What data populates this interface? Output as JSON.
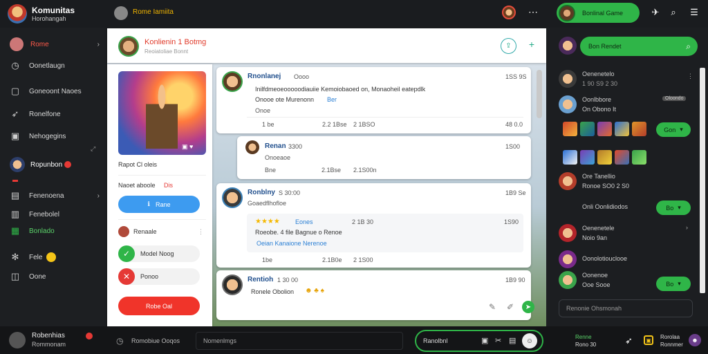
{
  "app": {
    "title": "Komunitas",
    "subtitle": "Horohangah"
  },
  "topbar": {
    "search_text": "Rome Iamiita",
    "right_label": "Bonlinal Game"
  },
  "sidebar": {
    "items": [
      {
        "label": "Rome"
      },
      {
        "label": "Oonetlaugn"
      },
      {
        "label": "Goneoont Naoes"
      },
      {
        "label": "Ronelfone"
      },
      {
        "label": "Nehogegins"
      },
      {
        "label": "Ropunbon"
      },
      {
        "label": "Fenenoena"
      },
      {
        "label": "Fenebolel"
      },
      {
        "label": "Bonlado"
      },
      {
        "label": "Fele"
      },
      {
        "label": "Oone"
      }
    ],
    "profile": {
      "name": "Robenhias",
      "sub": "Rommonam"
    }
  },
  "header": {
    "title": "Konlienin 1 Botmg",
    "subtitle": "Reoiatoliae Bonnt"
  },
  "leftcard": {
    "game_label": "Rapot Cl oleis",
    "next_label": "Naoet aboole",
    "next_badge": "Dis",
    "button_label": "Rane",
    "list": [
      {
        "label": "Renaale"
      },
      {
        "label": "Model Noog"
      },
      {
        "label": "Ponoo"
      }
    ],
    "danger_button": "Robe Oal"
  },
  "posts": [
    {
      "name": "Rnonlanej",
      "meta": "Oooo",
      "time": "1SS 9S",
      "text_line1": "Inilfdmeoeooooodiauiie Kemoiobaoed on, Monaoheil eatepdlk",
      "text_line2": "Onooe  ote Murenonn",
      "link": "Ber",
      "text_line3": "Onoe",
      "stat1": "1 be",
      "stat2": "2.2 1Bse",
      "stat3": "2 1BSO",
      "action": "48 0.0"
    },
    {
      "name": "Renan",
      "meta": "3300",
      "time": "1S00",
      "text_line1": "Onoeaoe",
      "stat1": "Bne",
      "stat2": "2.1Bse",
      "stat3": "2.1S00n"
    },
    {
      "name": "Ronblny",
      "meta": "S 30:00",
      "time": "1B9 Se",
      "text_line1": "Goaedflhofloe",
      "stars": "★★★★",
      "sub_name": "Eones",
      "sub_time": "2 1B 30",
      "sub_time2": "1S90",
      "sub_text1": "Roeobe. 4 file  Bagnue o Renoe",
      "sub_link": "Oeian Kanaione Nerenoe",
      "stat1": "1be",
      "stat2": "2.1B0e",
      "stat3": "2 1S00"
    },
    {
      "name": "Rentioh",
      "meta": "1 30 00",
      "time": "1B9 90",
      "text_line1": "Ronele Obolion"
    }
  ],
  "right": {
    "search_label": "Bon Rendet",
    "rows": [
      {
        "name": "Oenenetelo",
        "sub": "1 90 S9 2 30"
      },
      {
        "name": "Oonlbbore",
        "sub": "On Obono It",
        "badge": "Oloondo"
      },
      {
        "name": "Ore Tanellio",
        "sub": "Ronoe SO0 2 S0"
      },
      {
        "name": "Onli Oonlidiodos",
        "action": "Bo"
      },
      {
        "name": "Oenenetele",
        "sub": "Noio 9an"
      },
      {
        "name": "Oonolotiouclooe"
      },
      {
        "name": "Oonenoe",
        "sub": "Ooe Sooe"
      }
    ],
    "btn_go": "Gon",
    "btn_bo": "Bo",
    "btn_bo2": "Bo",
    "input_placeholder": "Renonie Ohsmonah"
  },
  "bottombar": {
    "left_label": "Romobiue Ooqos",
    "search_text": "Nomenlmgs",
    "compose_text": "Ranolbnl",
    "right1_name": "Renne",
    "right1_sub": "Rono 30",
    "right2_name": "Rorolaa",
    "right2_sub": "Ronnmer"
  }
}
